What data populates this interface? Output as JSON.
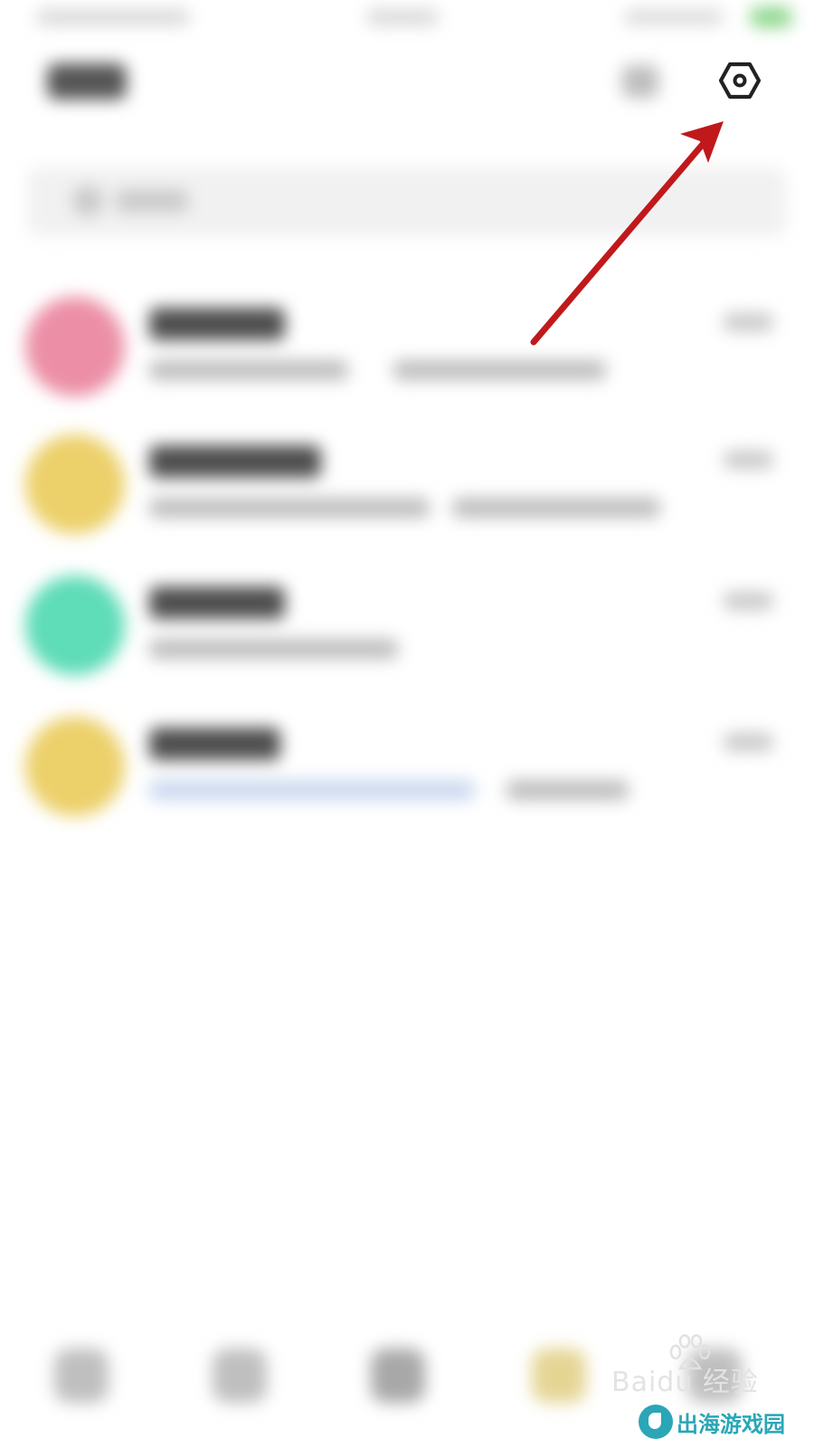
{
  "header": {
    "settings_icon": "hexagon-settings-icon"
  },
  "annotation": {
    "arrow_color": "#c0191c",
    "arrow_icon": "red-arrow-pointing-to-settings"
  },
  "watermark": {
    "baidu_text": "Baidu 经验",
    "site_text": "出海游戏园",
    "site_color": "#2aa6b6"
  },
  "conversation_list": {
    "avatar_colors": [
      "#ec8fa6",
      "#ecd06a",
      "#5fdcb8",
      "#ecd06a"
    ]
  }
}
